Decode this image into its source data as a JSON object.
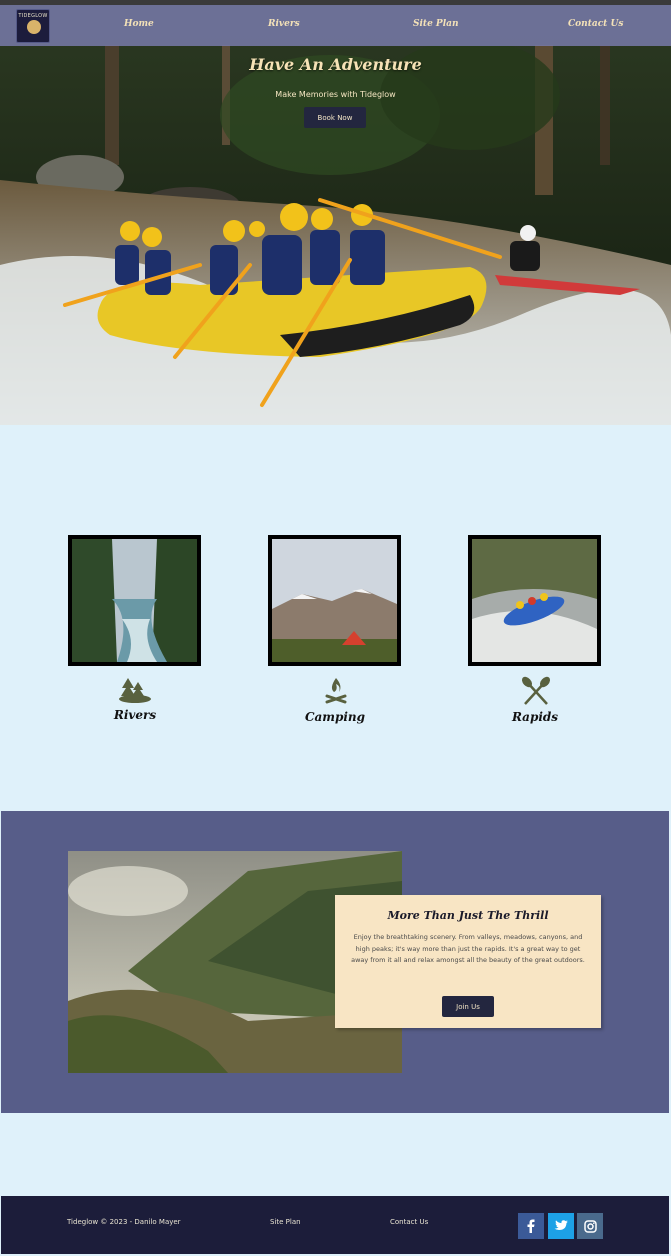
{
  "nav": {
    "logo_text": "TIDEGLOW",
    "links": [
      "Home",
      "Rivers",
      "Site Plan",
      "Contact Us"
    ]
  },
  "hero": {
    "title": "Have An Adventure",
    "subtitle": "Make Memories with Tideglow",
    "button": "Book Now"
  },
  "features": [
    {
      "label": "Rivers",
      "icon": "trees-icon"
    },
    {
      "label": "Camping",
      "icon": "campfire-icon"
    },
    {
      "label": "Rapids",
      "icon": "crossed-paddles-icon"
    }
  ],
  "promo": {
    "title": "More Than Just The Thrill",
    "text": "Enjoy the breathtaking scenery. From valleys, meadows, canyons, and high peaks; it's way more than just the rapids. It's a great way to get away from it all and relax amongst all the beauty of the great outdoors.",
    "button": "Join Us"
  },
  "footer": {
    "copyright": "Tideglow © 2023 - Danilo Mayer",
    "links": [
      "Site Plan",
      "Contact Us"
    ],
    "social": [
      "facebook-icon",
      "twitter-icon",
      "instagram-icon"
    ]
  },
  "colors": {
    "page_bg": "#dff1fa",
    "nav_bg": "#787aaa",
    "promo_bg": "#575d89",
    "card_bg": "#f8e5c4",
    "button_bg": "#23263f",
    "footer_bg": "#1c1d3a",
    "accent_text": "#f3e1b8"
  }
}
